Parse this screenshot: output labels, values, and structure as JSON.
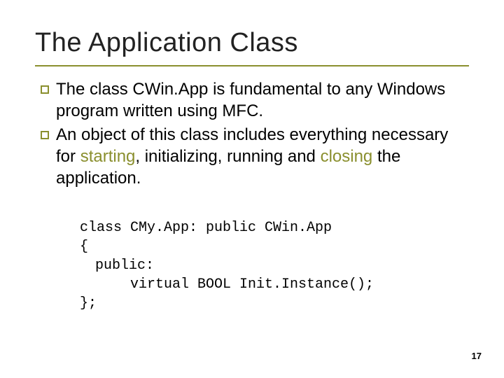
{
  "slide": {
    "title": "The Application Class",
    "bullets": [
      {
        "pre": "The class CWin.App is fundamental to any Windows program written using MFC."
      },
      {
        "pre": "An object of this class includes everything necessary for ",
        "h1": "starting",
        "mid1": ", initializing, running and ",
        "h2": "closing",
        "post": " the application."
      }
    ],
    "code": {
      "l1": "class CMy.App: public CWin.App",
      "l2": "{",
      "l3": "public:",
      "l4": "virtual BOOL Init.Instance();",
      "l5": "};"
    },
    "page_number": "17"
  }
}
